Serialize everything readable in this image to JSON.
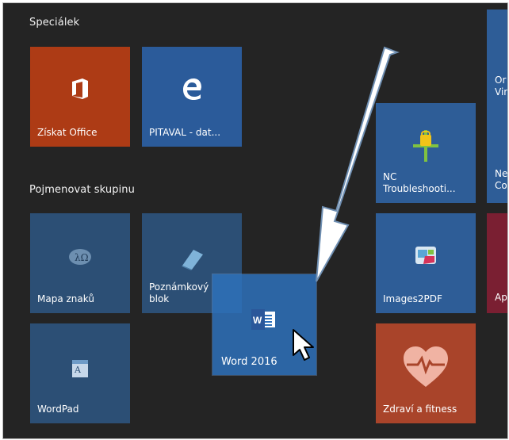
{
  "groups": {
    "first": "Speciálek",
    "second": "Pojmenovat skupinu"
  },
  "tiles": {
    "office": "Získat Office",
    "pitaval": "PITAVAL - dat...",
    "nc": "NC\nTroubleshooti...",
    "mapa": "Mapa znaků",
    "poznamkovy": "Poznámkový\nblok",
    "wordpad": "WordPad",
    "images2pdf": "Images2PDF",
    "zdravi": "Zdraví a fitness",
    "edge_right_top": "Or\nVir",
    "edge_right_mid": "Ne\nCo",
    "edge_right_low": "Ap"
  },
  "dragged_tile": {
    "label": "Word 2016",
    "icon": "word-icon"
  },
  "colors": {
    "background": "#242424",
    "tile_blue": "#2b5b9a",
    "tile_orange": "#ad3b15",
    "tile_red": "#7a1f32",
    "drag_blue": "#2e71bb"
  }
}
